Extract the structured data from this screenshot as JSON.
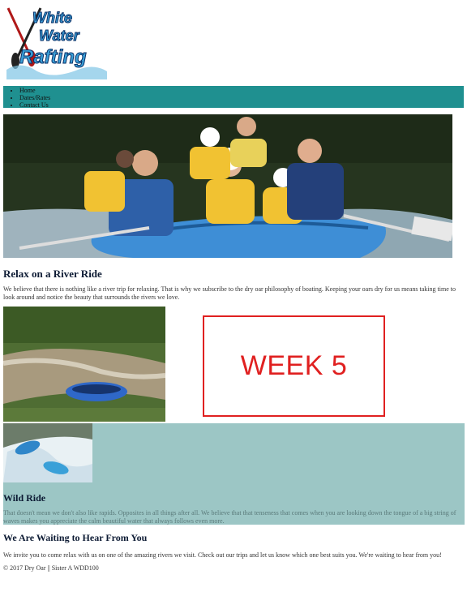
{
  "logo": {
    "line1": "White",
    "line2": "Water",
    "line3": "Rafting"
  },
  "nav": {
    "items": [
      "Home",
      "Dates/Rates",
      "Contact Us"
    ]
  },
  "relax": {
    "heading": "Relax on a River Ride",
    "text": "We believe that there is nothing like a river trip for relaxing. That is why we subscribe to the dry oar philosophy of boating. Keeping your oars dry for us means taking time to look around and notice the beauty that surrounds the rivers we love."
  },
  "week_box": {
    "text": "WEEK 5"
  },
  "wild": {
    "heading": "Wild Ride",
    "text": "That doesn't mean we don't also like rapids. Opposites in all things after all. We believe that that tenseness that comes when you are looking down the tongue of a big string of waves makes you appreciate the calm beautiful water that always follows even more."
  },
  "wait": {
    "heading": "We Are Waiting to Hear From You",
    "text": "We invite you to come relax with us on one of the amazing rivers we visit. Check out our trips and let us know which one best suits you. We're waiting to hear from you!"
  },
  "footer": {
    "text": "© 2017 Dry Oar || Sister A WDD100"
  },
  "colors": {
    "nav_bg": "#1f9090",
    "wild_bg": "#9cc6c5",
    "week_red": "#e02020",
    "heading": "#0c1a33"
  }
}
